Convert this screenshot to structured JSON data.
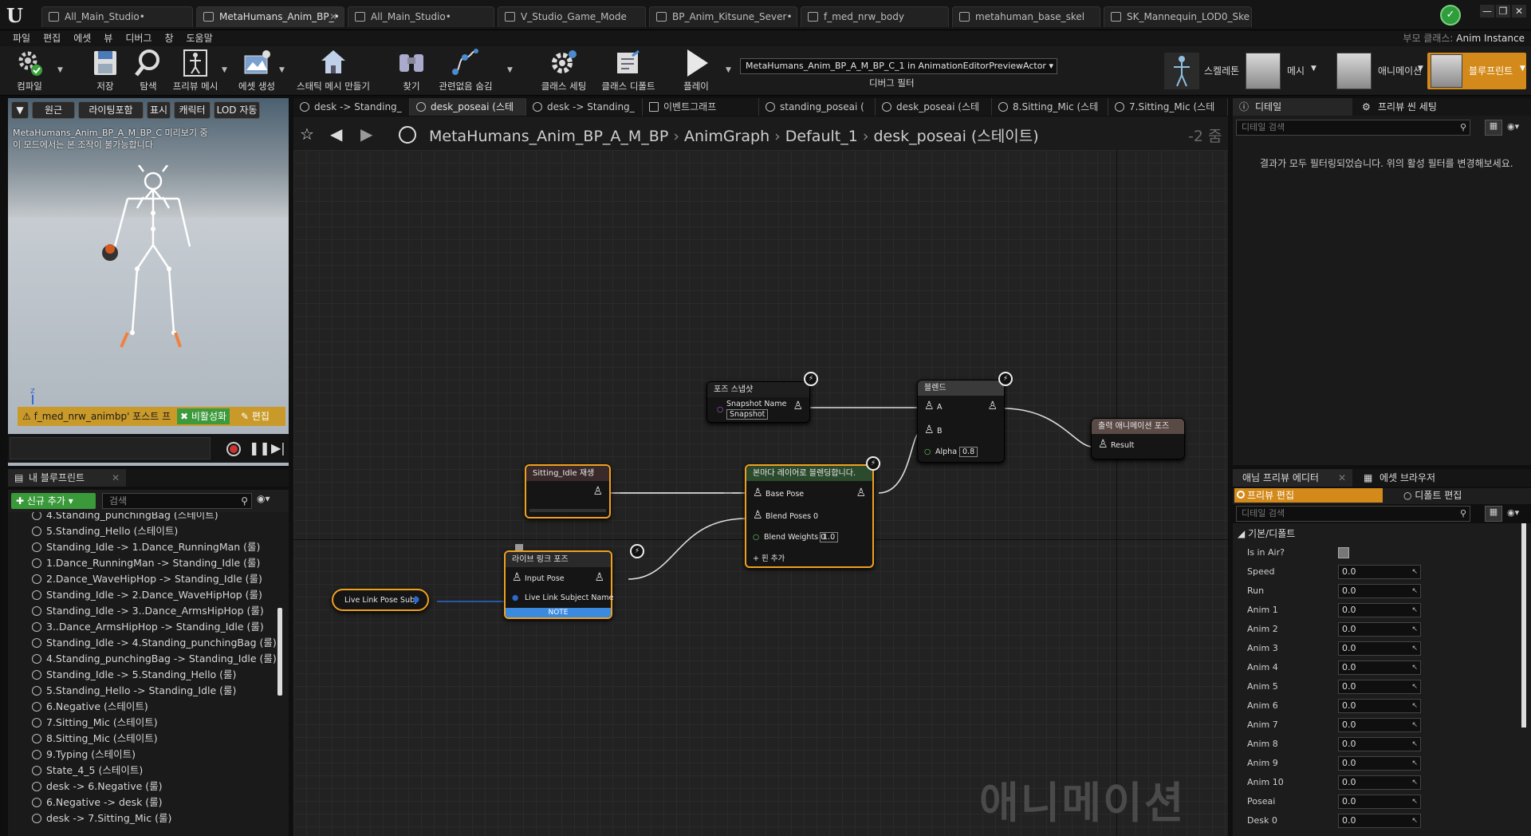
{
  "window": {
    "tabs": [
      {
        "label": "All_Main_Studio•"
      },
      {
        "label": "MetaHumans_Anim_BP_•"
      },
      {
        "label": "All_Main_Studio•"
      },
      {
        "label": "V_Studio_Game_Mode"
      },
      {
        "label": "BP_Anim_Kitsune_Sever•"
      },
      {
        "label": "f_med_nrw_body"
      },
      {
        "label": "metahuman_base_skel"
      },
      {
        "label": "SK_Mannequin_LOD0_Ske"
      }
    ],
    "parent_class_label": "부모 클래스:",
    "parent_class_value": "Anim Instance"
  },
  "menu": [
    "파일",
    "편집",
    "에셋",
    "뷰",
    "디버그",
    "창",
    "도움말"
  ],
  "toolbar": {
    "buttons": [
      {
        "label": "컴파일",
        "icon": "compile-icon"
      },
      {
        "label": "저장",
        "icon": "save-icon"
      },
      {
        "label": "탐색",
        "icon": "browse-icon"
      },
      {
        "label": "프리뷰 메시",
        "icon": "preview-mesh-icon"
      },
      {
        "label": "에셋 생성",
        "icon": "create-asset-icon"
      },
      {
        "label": "스태틱 메시 만들기",
        "icon": "static-mesh-icon"
      },
      {
        "label": "찾기",
        "icon": "find-icon"
      },
      {
        "label": "관련없음 숨김",
        "icon": "hide-unrelated-icon"
      },
      {
        "label": "클래스 세팅",
        "icon": "class-settings-icon"
      },
      {
        "label": "클래스 디폴트",
        "icon": "class-defaults-icon"
      },
      {
        "label": "플레이",
        "icon": "play-icon"
      }
    ],
    "debug_filter_value": "MetaHumans_Anim_BP_A_M_BP_C_1 in AnimationEditorPreviewActor",
    "debug_filter_label": "디버그 필터",
    "modes": [
      {
        "label": "스켈레톤"
      },
      {
        "label": "메시"
      },
      {
        "label": "애니메이션"
      },
      {
        "label": "블루프린트"
      }
    ]
  },
  "viewport": {
    "buttons": [
      "원근",
      "라이팅포함",
      "표시",
      "캐릭터",
      "LOD 자동"
    ],
    "preview_text_1": "MetaHumans_Anim_BP_A_M_BP_C 미리보기 중",
    "preview_text_2": "이 모드에서는 본 조작이 불가능합니다",
    "axis_label": "z",
    "warning_text": "f_med_nrw_animbp' 포스트 프",
    "disable_label": "비활성화",
    "edit_label": "편집"
  },
  "my_blueprint": {
    "tab_label": "내 블루프린트",
    "add_new_label": "신규 추가",
    "search_placeholder": "검색",
    "items": [
      "4.Standing_punchingBag (스테이트)",
      "5.Standing_Hello (스테이트)",
      "Standing_Idle -> 1.Dance_RunningMan (룰)",
      "1.Dance_RunningMan -> Standing_Idle (룰)",
      "2.Dance_WaveHipHop -> Standing_Idle (룰)",
      "Standing_Idle -> 2.Dance_WaveHipHop (룰)",
      "Standing_Idle -> 3..Dance_ArmsHipHop (룰)",
      "3..Dance_ArmsHipHop -> Standing_Idle (룰)",
      "Standing_Idle -> 4.Standing_punchingBag (룰)",
      "4.Standing_punchingBag -> Standing_Idle (룰)",
      "Standing_Idle -> 5.Standing_Hello (룰)",
      "5.Standing_Hello -> Standing_Idle (룰)",
      "6.Negative (스테이트)",
      "7.Sitting_Mic (스테이트)",
      "8.Sitting_Mic (스테이트)",
      "9.Typing (스테이트)",
      "State_4_5 (스테이트)",
      "desk -> 6.Negative (룰)",
      "6.Negative -> desk (룰)",
      "desk -> 7.Sitting_Mic (룰)"
    ]
  },
  "graph": {
    "tabs": [
      {
        "label": "desk -> Standing_"
      },
      {
        "label": "desk_poseai (스테"
      },
      {
        "label": "desk -> Standing_"
      },
      {
        "label": "이벤트그래프"
      },
      {
        "label": "standing_poseai ("
      },
      {
        "label": "desk_poseai (스테"
      },
      {
        "label": "8.Sitting_Mic (스테"
      },
      {
        "label": "7.Sitting_Mic (스테"
      }
    ],
    "breadcrumb": [
      "MetaHumans_Anim_BP_A_M_BP",
      "AnimGraph",
      "Default_1",
      "desk_poseai (스테이트)"
    ],
    "zoom": "-2 줌",
    "watermark": "애니메이션",
    "nodes": {
      "snapshot": {
        "title": "포즈 스냅샷",
        "pin": "Snapshot Name",
        "value": "Snapshot"
      },
      "blend": {
        "title": "블렌드",
        "pin_a": "A",
        "pin_b": "B",
        "alpha": "Alpha",
        "alpha_value": "0.8"
      },
      "output": {
        "title": "출력 애니메이션 포즈",
        "pin": "Result"
      },
      "sitting": {
        "title": "Sitting_Idle 재생"
      },
      "layered": {
        "title": "본마다 레이어로 블렌딩합니다.",
        "base": "Base Pose",
        "blend0": "Blend Poses 0",
        "weights": "Blend Weights 0",
        "weights_value": "1.0",
        "add_pin": "핀 추가"
      },
      "livelink": {
        "title": "라이브 링크 포즈",
        "input": "Input Pose",
        "subject": "Live Link Subject Name",
        "note": "NOTE"
      },
      "subject_var": {
        "title": "Live Link Pose Subj"
      }
    }
  },
  "details": {
    "tabs": [
      "디테일",
      "프리뷰 씬 세팅"
    ],
    "search_placeholder": "디테일 검색",
    "message": "결과가 모두 필터링되었습니다. 위의 활성 필터를 변경해보세요."
  },
  "anim_preview": {
    "tabs": [
      "애님 프리뷰 에디터",
      "에셋 브라우저"
    ],
    "edit_preview": "프리뷰 편집",
    "edit_defaults": "디폴트 편집",
    "search_placeholder": "디테일 검색",
    "category": "기본/디폴트",
    "props": [
      {
        "name": "Is in Air?",
        "value": ""
      },
      {
        "name": "Speed",
        "value": "0.0"
      },
      {
        "name": "Run",
        "value": "0.0"
      },
      {
        "name": "Anim 1",
        "value": "0.0"
      },
      {
        "name": "Anim 2",
        "value": "0.0"
      },
      {
        "name": "Anim 3",
        "value": "0.0"
      },
      {
        "name": "Anim 4",
        "value": "0.0"
      },
      {
        "name": "Anim 5",
        "value": "0.0"
      },
      {
        "name": "Anim 6",
        "value": "0.0"
      },
      {
        "name": "Anim 7",
        "value": "0.0"
      },
      {
        "name": "Anim 8",
        "value": "0.0"
      },
      {
        "name": "Anim 9",
        "value": "0.0"
      },
      {
        "name": "Anim 10",
        "value": "0.0"
      },
      {
        "name": "Poseai",
        "value": "0.0"
      },
      {
        "name": "Desk 0",
        "value": "0.0"
      }
    ]
  }
}
